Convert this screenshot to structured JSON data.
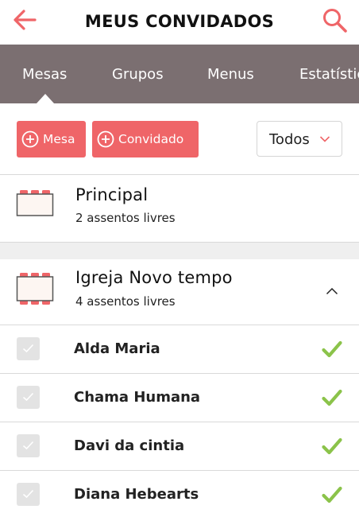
{
  "header": {
    "title": "MEUS CONVIDADOS",
    "back_icon": "arrow-left-icon",
    "search_icon": "search-icon"
  },
  "tabs": [
    {
      "label": "Mesas",
      "active": true
    },
    {
      "label": "Grupos",
      "active": false
    },
    {
      "label": "Menus",
      "active": false
    },
    {
      "label": "Estatísticas",
      "active": false
    }
  ],
  "actions": {
    "add_table_label": "Mesa",
    "add_guest_label": "Convidado",
    "filter_value": "Todos"
  },
  "tables": [
    {
      "name": "Principal",
      "seats": "2 assentos livres",
      "expanded": false
    },
    {
      "name": "Igreja Novo tempo",
      "seats": "4 assentos livres",
      "expanded": true
    }
  ],
  "guests": [
    {
      "name": "Alda Maria",
      "confirmed": true
    },
    {
      "name": "Chama Humana",
      "confirmed": true
    },
    {
      "name": "Davi da cintia",
      "confirmed": true
    },
    {
      "name": "Diana Hebearts",
      "confirmed": true
    }
  ],
  "colors": {
    "accent": "#ef6568",
    "tabbar": "#7b6f71",
    "confirm": "#8bc34a",
    "checkbox": "#e3e3e3"
  }
}
